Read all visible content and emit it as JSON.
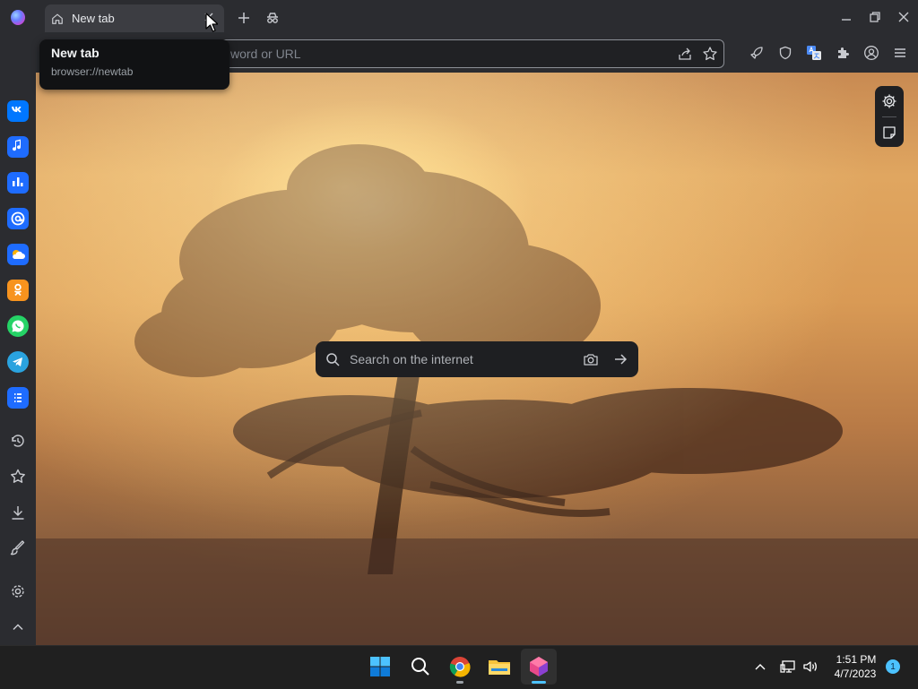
{
  "browser": {
    "tab": {
      "title": "New tab"
    },
    "omnibox": {
      "placeholder": "word or URL"
    },
    "tooltip": {
      "title": "New tab",
      "url": "browser://newtab"
    }
  },
  "newtab": {
    "search": {
      "placeholder": "Search on the internet"
    }
  },
  "sidebar": {
    "apps": [
      {
        "name": "vk-icon",
        "color": "#0077ff"
      },
      {
        "name": "music-icon",
        "color": "#1e6cff"
      },
      {
        "name": "stats-icon",
        "color": "#1e6cff"
      },
      {
        "name": "mail-icon",
        "color": "#1e6cff"
      },
      {
        "name": "cloud-icon",
        "color": "#1e6cff"
      },
      {
        "name": "odnoklassniki-icon",
        "color": "#f7931e"
      },
      {
        "name": "whatsapp-icon",
        "color": "#25d366"
      },
      {
        "name": "telegram-icon",
        "color": "#2aa3df"
      },
      {
        "name": "tasks-icon",
        "color": "#1e6cff"
      }
    ],
    "tools": [
      "history-icon",
      "bookmarks-icon",
      "downloads-icon",
      "themes-icon",
      "settings-icon",
      "collapse-icon"
    ]
  },
  "taskbar": {
    "apps": [
      "start-icon",
      "search-icon",
      "chrome-icon",
      "file-explorer-icon",
      "browser-icon"
    ],
    "clock": {
      "time": "1:51 PM",
      "date": "4/7/2023"
    },
    "notifications": "1"
  }
}
